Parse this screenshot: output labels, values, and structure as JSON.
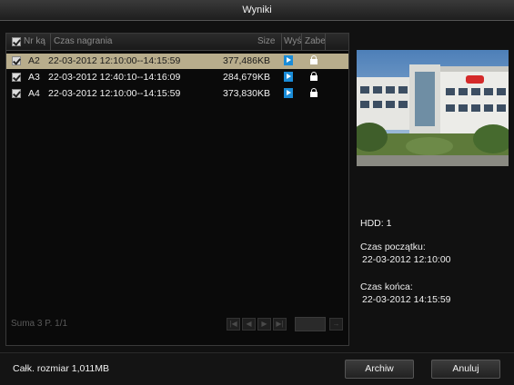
{
  "window": {
    "title": "Wyniki"
  },
  "table": {
    "headers": {
      "no": "Nr ką",
      "time": "Czas nagrania",
      "size": "Size",
      "play": "Wyś",
      "lock": "Zabe"
    },
    "rows": [
      {
        "no": "A2",
        "time": "22-03-2012 12:10:00--14:15:59",
        "size": "377,486KB",
        "selected": true
      },
      {
        "no": "A3",
        "time": "22-03-2012 12:40:10--14:16:09",
        "size": "284,679KB",
        "selected": false
      },
      {
        "no": "A4",
        "time": "22-03-2012 12:10:00--14:15:59",
        "size": "373,830KB",
        "selected": false
      }
    ],
    "footer": {
      "summary": "Suma 3  P. 1/1"
    }
  },
  "details": {
    "hdd_label": "HDD: 1",
    "start_label": "Czas początku:",
    "start_value": "22-03-2012 12:10:00",
    "end_label": "Czas końca:",
    "end_value": "22-03-2012 14:15:59"
  },
  "bottom": {
    "total_size": "Całk. rozmiar 1,011MB",
    "archive_label": "Archiw",
    "cancel_label": "Anuluj"
  }
}
